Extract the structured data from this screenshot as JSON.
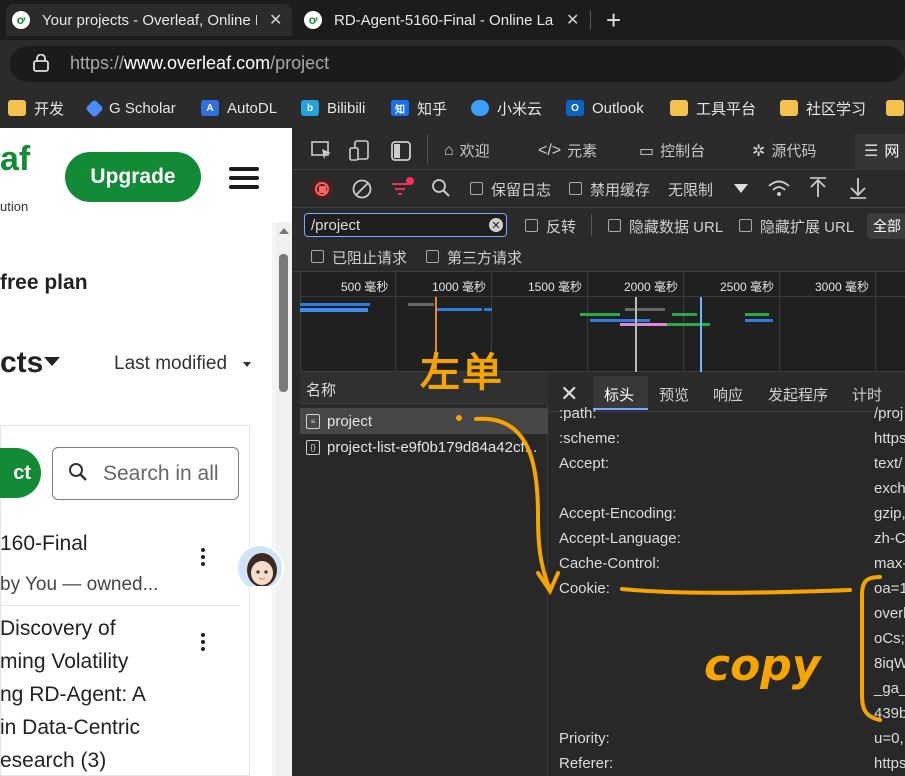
{
  "browser": {
    "tabs": [
      {
        "title": "Your projects - Overleaf, Online L",
        "active": true
      },
      {
        "title": "RD-Agent-5160-Final - Online La",
        "active": false
      }
    ],
    "url_prefix": "https://",
    "url_host": "www.overleaf.com",
    "url_path": "/project",
    "bookmarks": [
      {
        "label": "开发",
        "icon": "folder-icon"
      },
      {
        "label": "G Scholar",
        "icon": "scholar-icon"
      },
      {
        "label": "AutoDL",
        "icon": "autodl-icon"
      },
      {
        "label": "Bilibili",
        "icon": "bilibili-icon"
      },
      {
        "label": "知乎",
        "icon": "zhihu-icon"
      },
      {
        "label": "小米云",
        "icon": "cloud-icon"
      },
      {
        "label": "Outlook",
        "icon": "outlook-icon"
      },
      {
        "label": "工具平台",
        "icon": "folder-icon"
      },
      {
        "label": "社区学习",
        "icon": "folder-icon"
      }
    ]
  },
  "overleaf": {
    "logo_text": "af",
    "logo_sub": "ution",
    "upgrade_label": "Upgrade",
    "plan_text": "free plan",
    "projects_heading": "cts",
    "sort_label": "Last modified",
    "new_project_label": "ct",
    "search_placeholder": "Search in all",
    "projects": [
      {
        "title": "160-Final",
        "sub": "by You — owned..."
      },
      {
        "title_lines": [
          "Discovery of",
          "ming Volatility",
          "ng RD-Agent: A",
          "in Data-Centric",
          "esearch (3)"
        ]
      }
    ]
  },
  "devtools": {
    "top_tabs": [
      {
        "label": "欢迎",
        "icon": "home-icon"
      },
      {
        "label": "元素",
        "icon": "code-icon"
      },
      {
        "label": "控制台",
        "icon": "console-icon"
      },
      {
        "label": "源代码",
        "icon": "bug-icon"
      },
      {
        "label": "网",
        "icon": "wifi-icon"
      }
    ],
    "toolbar": {
      "preserve_log": "保留日志",
      "disable_cache": "禁用缓存",
      "throttling": "无限制"
    },
    "filter": {
      "value": "/project",
      "invert": "反转",
      "hide_data_urls": "隐藏数据 URL",
      "hide_ext_urls": "隐藏扩展 URL",
      "all": "全部",
      "blocked_requests": "已阻止请求",
      "third_party": "第三方请求"
    },
    "timeline_ticks": [
      "500 毫秒",
      "1000 毫秒",
      "1500 毫秒",
      "2000 毫秒",
      "2500 毫秒",
      "3000 毫秒"
    ],
    "list_header": "名称",
    "requests": [
      {
        "name": "project",
        "selected": true
      },
      {
        "name": "project-list-e9f0b179d84a42cf...",
        "selected": false
      }
    ],
    "detail_tabs": [
      "标头",
      "预览",
      "响应",
      "发起程序",
      "计时"
    ],
    "headers": [
      {
        "key": ":path:",
        "value": "/proj"
      },
      {
        "key": ":scheme:",
        "value": "https"
      },
      {
        "key": "Accept:",
        "value": "text/"
      },
      {
        "key": "",
        "value": "exch"
      },
      {
        "key": "Accept-Encoding:",
        "value": "gzip,"
      },
      {
        "key": "Accept-Language:",
        "value": "zh-C"
      },
      {
        "key": "Cache-Control:",
        "value": "max-"
      },
      {
        "key": "Cookie:",
        "value": "oa=1"
      },
      {
        "key": "",
        "value": "overl"
      },
      {
        "key": "",
        "value": "oCs;"
      },
      {
        "key": "",
        "value": "8iqW"
      },
      {
        "key": "",
        "value": "_ga_"
      },
      {
        "key": "",
        "value": "439b"
      },
      {
        "key": "Priority:",
        "value": "u=0,"
      },
      {
        "key": "Referer:",
        "value": "https"
      }
    ]
  },
  "annotations": {
    "left_click_note": "左单",
    "copy_note": "copy"
  },
  "colors": {
    "overleaf_green": "#138a36",
    "annotation_orange": "#f5a400",
    "devtools_bg": "#282828"
  }
}
